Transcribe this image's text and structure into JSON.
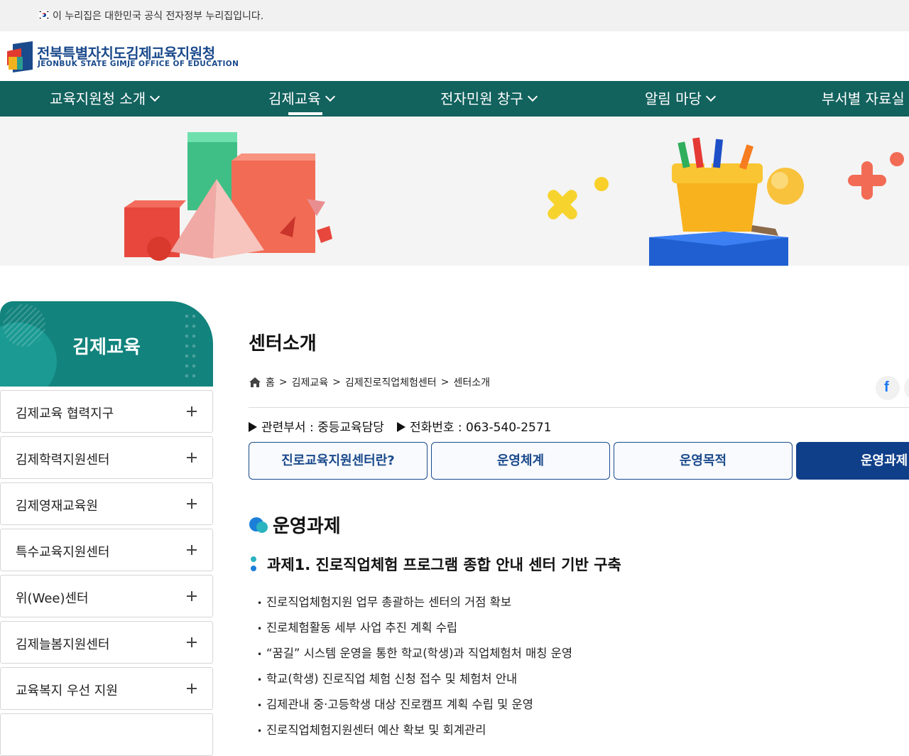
{
  "gov_banner": {
    "text": "이 누리집은 대한민국 공식 전자정부 누리집입니다."
  },
  "logo": {
    "name_kr": "전북특별자치도김제교육지원청",
    "name_en": "JEONBUK STATE GIMJE OFFICE OF EDUCATION"
  },
  "gnb": {
    "items": [
      {
        "label": "교육지원청 소개"
      },
      {
        "label": "김제교육"
      },
      {
        "label": "전자민원 창구"
      },
      {
        "label": "알림 마당"
      },
      {
        "label": "부서별 자료실"
      }
    ],
    "active_index": 1
  },
  "sidebar": {
    "title": "김제교육",
    "items": [
      {
        "label": "김제교육 협력지구"
      },
      {
        "label": "김제학력지원센터"
      },
      {
        "label": "김제영재교육원"
      },
      {
        "label": "특수교육지원센터"
      },
      {
        "label": "위(Wee)센터"
      },
      {
        "label": "김제늘봄지원센터"
      },
      {
        "label": "교육복지 우선 지원"
      },
      {
        "label": ""
      }
    ]
  },
  "content": {
    "page_title": "센터소개",
    "breadcrumb": [
      "홈",
      "김제교육",
      "김제진로직업체험센터",
      "센터소개"
    ],
    "breadcrumb_sep": ">",
    "dept": {
      "label": "관련부서 : 중등교육담당",
      "phone_label": "전화번호 : 063-540-2571"
    },
    "tabs": [
      {
        "label": "진로교육지원센터란?"
      },
      {
        "label": "운영체계"
      },
      {
        "label": "운영목적"
      },
      {
        "label": "운영과제"
      }
    ],
    "active_tab_index": 3,
    "section_title": "운영과제",
    "task_title": "과제1. 진로직업체험 프로그램 종합 안내 센터 기반 구축",
    "bullets": [
      "진로직업체험지원 업무 총괄하는 센터의 거점 확보",
      "진로체험활동 세부 사업 추진 계획 수립",
      "“꿈길” 시스템 운영을 통한 학교(학생)과 직업체험처 매칭 운영",
      "학교(학생) 진로직업 체험 신청 접수 및 체험처 안내",
      "김제관내 중·고등학생 대상 진로캠프 계획 수립 및 운영",
      "진로직업체험지원센터 예산 확보 및 회계관리"
    ]
  },
  "icons": {
    "flag": "korea-flag-icon",
    "home": "home-icon",
    "share": "facebook-icon",
    "plus": "plus-icon",
    "chevron": "chevron-down-icon"
  },
  "colors": {
    "gnb_bg": "#12625e",
    "sidebar_head": "#12837d",
    "brand_blue": "#1b4a8c",
    "active_tab": "#103f8a"
  }
}
